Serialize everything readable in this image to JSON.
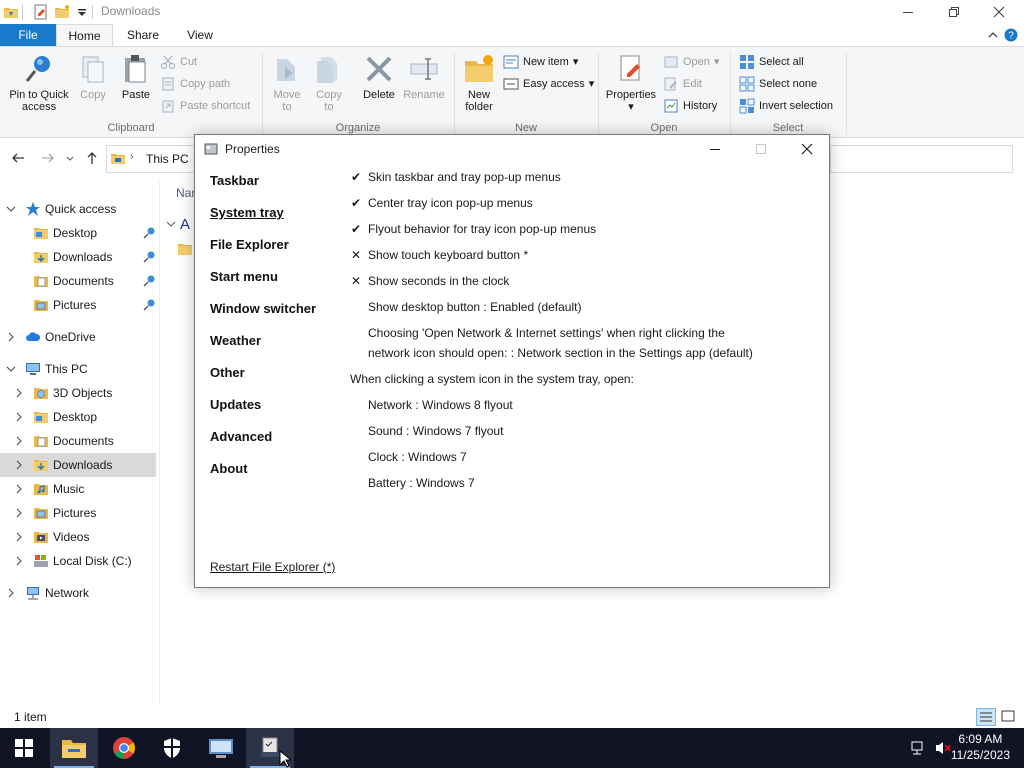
{
  "window": {
    "title": "Downloads"
  },
  "ribbon": {
    "tabs": {
      "file": "File",
      "home": "Home",
      "share": "Share",
      "view": "View"
    },
    "clipboard": {
      "pin_label_1": "Pin to Quick",
      "pin_label_2": "access",
      "copy": "Copy",
      "paste": "Paste",
      "cut": "Cut",
      "copy_path": "Copy path",
      "paste_shortcut": "Paste shortcut",
      "group_label": "Clipboard"
    },
    "organize": {
      "move_to_1": "Move",
      "move_to_2": "to",
      "copy_to_1": "Copy",
      "copy_to_2": "to",
      "delete": "Delete",
      "rename": "Rename",
      "group_label": "Organize"
    },
    "new": {
      "new_folder_1": "New",
      "new_folder_2": "folder",
      "new_item": "New item",
      "easy_access": "Easy access",
      "group_label": "New"
    },
    "open": {
      "properties": "Properties",
      "open": "Open",
      "edit": "Edit",
      "history": "History",
      "group_label": "Open"
    },
    "select": {
      "select_all": "Select all",
      "select_none": "Select none",
      "invert_selection": "Invert selection",
      "group_label": "Select"
    }
  },
  "address": {
    "path": "This PC"
  },
  "nav_pane": {
    "quick_access": "Quick access",
    "qa_items": [
      "Desktop",
      "Downloads",
      "Documents",
      "Pictures"
    ],
    "onedrive": "OneDrive",
    "this_pc": "This PC",
    "pc_items": [
      "3D Objects",
      "Desktop",
      "Documents",
      "Downloads",
      "Music",
      "Pictures",
      "Videos",
      "Local Disk (C:)"
    ],
    "network": "Network"
  },
  "content": {
    "col_header_partial": "Nar",
    "group_header_partial": "A"
  },
  "status": {
    "item_count": "1 item"
  },
  "dialog": {
    "title": "Properties",
    "nav": [
      "Taskbar",
      "System tray",
      "File Explorer",
      "Start menu",
      "Window switcher",
      "Weather",
      "Other",
      "Updates",
      "Advanced",
      "About"
    ],
    "active_nav": "System tray",
    "options": [
      {
        "mark": "✔",
        "text": "Skin taskbar and tray pop-up menus"
      },
      {
        "mark": "✔",
        "text": "Center tray icon pop-up menus"
      },
      {
        "mark": "✔",
        "text": "Flyout behavior for tray icon pop-up menus"
      },
      {
        "mark": "✕",
        "text": "Show touch keyboard button *"
      },
      {
        "mark": "✕",
        "text": "Show seconds in the clock"
      },
      {
        "mark": "",
        "text": "Show desktop button : Enabled (default)"
      }
    ],
    "network_option_line1": "Choosing 'Open Network & Internet settings' when right clicking the",
    "network_option_line2": "network icon should open: : Network section in the Settings app (default)",
    "tray_heading": "When clicking a system icon in the system tray, open:",
    "tray_options": [
      "Network : Windows 8 flyout",
      "Sound : Windows 7 flyout",
      "Clock : Windows 7",
      "Battery : Windows 7"
    ],
    "restart_link": "Restart File Explorer (*)"
  },
  "taskbar": {
    "time": "6:09 AM",
    "date": "11/25/2023"
  },
  "colors": {
    "file_tab": "#1979ca",
    "taskbar": "#101424",
    "selection": "#d9d9d9",
    "folder": "#e8b84a"
  }
}
